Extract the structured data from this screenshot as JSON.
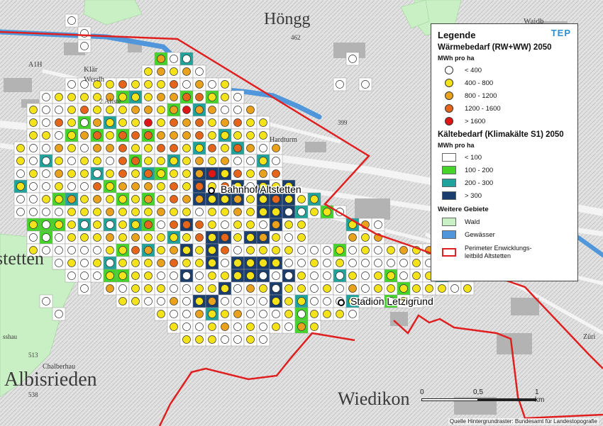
{
  "map_labels": [
    {
      "text": "Höngg",
      "size": 24
    },
    {
      "text": "462",
      "size": 9
    },
    {
      "text": "Waidb",
      "size": 11
    },
    {
      "text": "A1H",
      "size": 10
    },
    {
      "text": "Klär",
      "size": 11
    },
    {
      "text": "Werdh",
      "size": 11
    },
    {
      "text": "2 Altste",
      "size": 10
    },
    {
      "text": "399",
      "size": 9
    },
    {
      "text": "Hardturm",
      "size": 10
    },
    {
      "text": "stetten",
      "size": 26
    },
    {
      "text": "sshau",
      "size": 9
    },
    {
      "text": "513",
      "size": 9
    },
    {
      "text": "Chalberhau",
      "size": 10
    },
    {
      "text": "Albisrieden",
      "size": 28
    },
    {
      "text": "538",
      "size": 9
    },
    {
      "text": "Wiedikon",
      "size": 26
    },
    {
      "text": "Züri",
      "size": 10
    }
  ],
  "places": {
    "bahnhof": "Bahnhof Altstetten",
    "stadion": "Stadion Letzigrund"
  },
  "legend": {
    "title": "Legende",
    "brand": "TEP",
    "heat_title": "Wärmebedarf (RW+WW) 2050",
    "heat_unit": "MWh pro ha",
    "heat_classes": [
      {
        "label": "< 400",
        "color": "#ffffff"
      },
      {
        "label": "400 - 800",
        "color": "#f5e31a"
      },
      {
        "label": "800 - 1200",
        "color": "#eaa21c"
      },
      {
        "label": "1200 - 1600",
        "color": "#e5661a"
      },
      {
        "label": "> 1600",
        "color": "#e01616"
      }
    ],
    "cool_title": "Kältebedarf (Klimakälte S1) 2050",
    "cool_unit": "MWh pro ha",
    "cool_classes": [
      {
        "label": "< 100",
        "color": "#ffffff"
      },
      {
        "label": "100 - 200",
        "color": "#45d42a"
      },
      {
        "label": "200 - 300",
        "color": "#1fa39a"
      },
      {
        "label": "> 300",
        "color": "#1a3e6e"
      }
    ],
    "other_title": "Weitere Gebiete",
    "other_classes": [
      {
        "label": "Wald",
        "color": "#c9f0c4"
      },
      {
        "label": "Gewässer",
        "color": "#4f97da"
      }
    ],
    "perimeter_line1": "Perimeter Enwicklungs-",
    "perimeter_line2": "leitbild Altstetten"
  },
  "scale": {
    "l0": "0",
    "l1": "0,5",
    "l2": "1 km"
  },
  "source": "Quelle Hintergrundraster: Bundesamt für Landestopografie"
}
